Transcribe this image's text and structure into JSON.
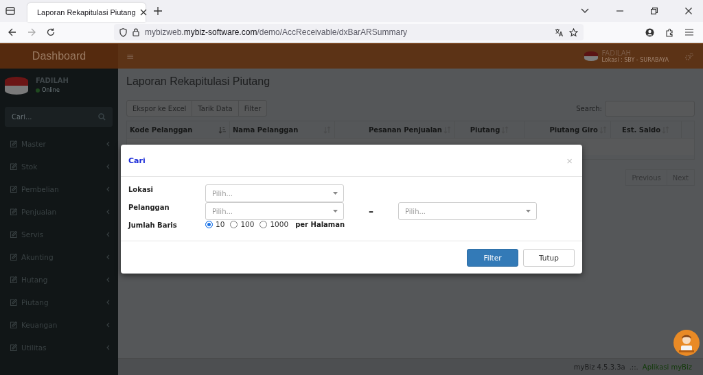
{
  "browser": {
    "tab_title": "Laporan Rekapitulasi Piutang",
    "url": "mybizweb.**mybiz-software.com**/demo/AccReceivable/dxBarARSummary"
  },
  "header": {
    "brand": "Dashboard",
    "menu_glyph": "≡",
    "user_name": "FADILAH",
    "location": "Lokasi : SBY - SURABAYA"
  },
  "sidebar": {
    "user_name": "FADILAH",
    "status": "Online",
    "search_placeholder": "Cari...",
    "items": [
      {
        "label": "Master"
      },
      {
        "label": "Stok"
      },
      {
        "label": "Pembelian"
      },
      {
        "label": "Penjualan"
      },
      {
        "label": "Servis"
      },
      {
        "label": "Akunting"
      },
      {
        "label": "Hutang"
      },
      {
        "label": "Piutang"
      },
      {
        "label": "Keuangan"
      },
      {
        "label": "Utilitas"
      }
    ]
  },
  "page": {
    "title": "Laporan Rekapitulasi Piutang",
    "toolbar": [
      "Ekspor ke Excel",
      "Tarik Data",
      "Filter"
    ],
    "search_label": "Search:",
    "table": {
      "columns": [
        {
          "label": "Kode Pelanggan",
          "sorted": true
        },
        {
          "label": "Nama Pelanggan",
          "sorted": false
        },
        {
          "label": "Pesanan Penjualan",
          "sorted": false
        },
        {
          "label": "Piutang",
          "sorted": false
        },
        {
          "label": "Piutang Giro",
          "sorted": false
        },
        {
          "label": "Est. Saldo",
          "sorted": false
        }
      ]
    },
    "pagination": [
      "Previous",
      "Next"
    ]
  },
  "footer": {
    "version": "myBiz 4.5.3.3a",
    "separator": ".::.",
    "link": "Aplikasi myBiz"
  },
  "modal": {
    "title": "Cari",
    "close_glyph": "×",
    "rows": [
      {
        "label": "Lokasi",
        "kind": "select",
        "selects": [
          "Pilih..."
        ]
      },
      {
        "label": "Pelanggan",
        "kind": "range",
        "selects": [
          "Pilih...",
          "Pilih..."
        ],
        "separator": "–"
      },
      {
        "label": "Jumlah Baris",
        "kind": "radio",
        "options": [
          {
            "label": "10",
            "selected": true
          },
          {
            "label": "100",
            "selected": false
          },
          {
            "label": "1000",
            "selected": false
          }
        ],
        "suffix": "per Halaman"
      }
    ],
    "buttons": [
      {
        "label": "Filter",
        "kind": "primary"
      },
      {
        "label": "Tutup",
        "kind": "default"
      }
    ]
  }
}
